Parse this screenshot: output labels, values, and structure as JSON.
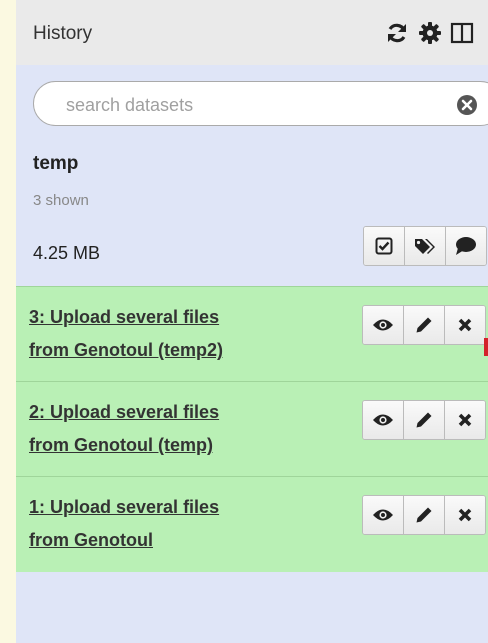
{
  "header": {
    "title": "History",
    "icons": [
      "refresh-icon",
      "gear-icon",
      "columns-icon"
    ]
  },
  "search": {
    "placeholder": "search datasets",
    "value": ""
  },
  "history": {
    "name": "temp",
    "shown": "3 shown",
    "size": "4.25 MB",
    "actions": [
      "select-icon",
      "tags-icon",
      "annotation-icon"
    ]
  },
  "datasets": [
    {
      "title_line1": "3: Upload several files",
      "title_line2": "from Genotoul (temp2)",
      "state": "ok"
    },
    {
      "title_line1": "2: Upload several files",
      "title_line2": "from Genotoul (temp)",
      "state": "ok"
    },
    {
      "title_line1": "1: Upload several files",
      "title_line2": "from Genotoul",
      "state": "ok"
    }
  ],
  "dataset_actions": [
    "eye-icon",
    "pencil-icon",
    "delete-icon"
  ],
  "colors": {
    "panel": "#dfe5f7",
    "header": "#eaeaea",
    "dataset_ok": "#b9f0b5",
    "page": "#fbf9e1",
    "marker": "#d3222a"
  }
}
